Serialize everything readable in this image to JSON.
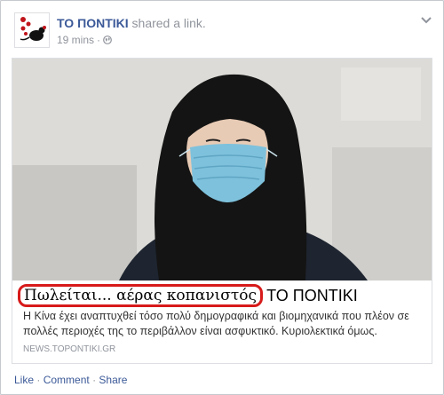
{
  "post": {
    "page_name": "ΤΟ ΠΟΝΤΙΚΙ",
    "action_text": "shared a link.",
    "time": "19 mins",
    "separator": "·"
  },
  "link": {
    "title": "Πωλείται... αέρας κοπανιστός",
    "site_name": "ΤΟ ΠΟΝΤΙΚΙ",
    "description": "Η Κίνα έχει αναπτυχθεί τόσο πολύ δημογραφικά και βιομηχανικά που πλέον σε πολλές περιοχές της το περιβάλλον είναι ασφυκτικό. Κυριολεκτικά όμως.",
    "domain": "NEWS.TOPONTIKI.GR"
  },
  "actions": {
    "like": "Like",
    "comment": "Comment",
    "share": "Share",
    "separator": "·"
  },
  "icons": {
    "avatar": "mouse-logo-icon",
    "audience": "globe-icon",
    "menu": "chevron-down-icon"
  },
  "colors": {
    "link_blue": "#3b5998",
    "meta_gray": "#90949c",
    "highlight_red": "#d71a1a",
    "mask_blue": "#7ec1dc"
  }
}
